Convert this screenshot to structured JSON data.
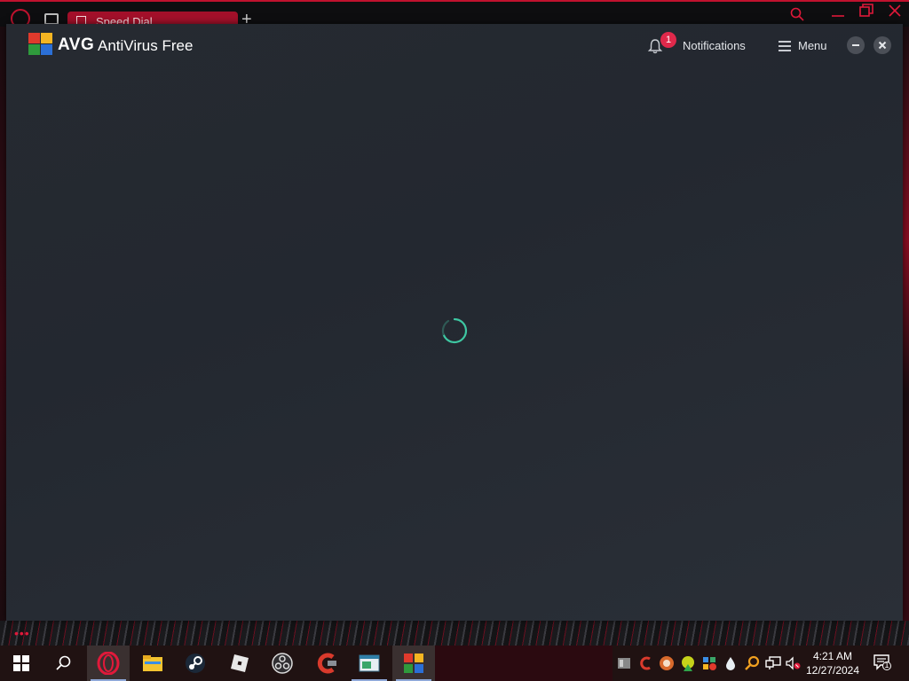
{
  "browser": {
    "tab_title": "Speed Dial"
  },
  "avg": {
    "brand": "AVG",
    "product": "AntiVirus Free",
    "notifications_label": "Notifications",
    "notifications_count": "1",
    "menu_label": "Menu",
    "colors": {
      "background": "#262a31",
      "badge": "#e0294b",
      "spinner": "#3ec7a2"
    }
  },
  "taskbar": {
    "apps": [
      "start-icon",
      "search-icon",
      "opera-icon",
      "file-explorer-icon",
      "steam-icon",
      "roblox-icon",
      "obs-icon",
      "ccleaner-icon",
      "app-window-icon",
      "avg-icon"
    ],
    "time": "4:21 AM",
    "date": "12/27/2024",
    "action_center_count": "1"
  }
}
